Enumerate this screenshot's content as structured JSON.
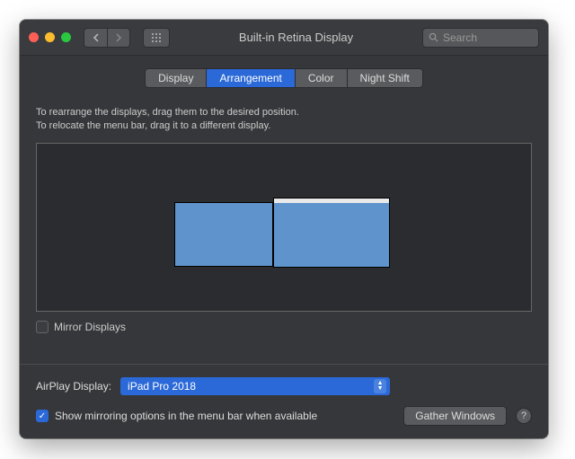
{
  "window": {
    "title": "Built-in Retina Display"
  },
  "toolbar": {
    "search_placeholder": "Search"
  },
  "tabs": {
    "display": "Display",
    "arrangement": "Arrangement",
    "color": "Color",
    "night_shift": "Night Shift"
  },
  "instructions": {
    "line1": "To rearrange the displays, drag them to the desired position.",
    "line2": "To relocate the menu bar, drag it to a different display."
  },
  "mirror": {
    "label": "Mirror Displays",
    "checked": false
  },
  "airplay": {
    "label": "AirPlay Display:",
    "selected": "iPad Pro 2018"
  },
  "options": {
    "show_mirroring_label": "Show mirroring options in the menu bar when available",
    "show_mirroring_checked": true
  },
  "buttons": {
    "gather": "Gather Windows"
  }
}
